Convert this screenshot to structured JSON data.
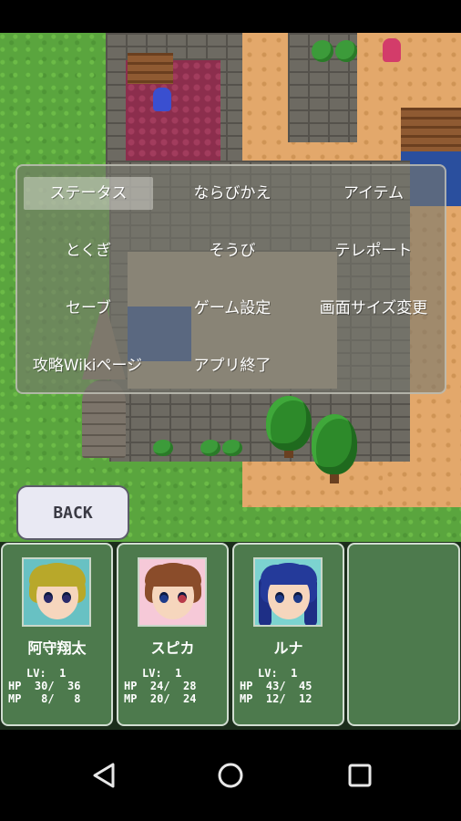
{
  "menu": {
    "items": [
      "ステータス",
      "ならびかえ",
      "アイテム",
      "とくぎ",
      "そうび",
      "テレポート",
      "セーブ",
      "ゲーム設定",
      "画面サイズ変更",
      "攻略Wikiページ",
      "アプリ終了"
    ],
    "selected_index": 0
  },
  "back_label": "BACK",
  "party": [
    {
      "name": "阿守翔太",
      "lv": "LV:  1",
      "hp": "HP  30/  36",
      "mp": "MP   8/   8"
    },
    {
      "name": "スピカ",
      "lv": "LV:  1",
      "hp": "HP  24/  28",
      "mp": "MP  20/  24"
    },
    {
      "name": "ルナ",
      "lv": "LV:  1",
      "hp": "HP  43/  45",
      "mp": "MP  12/  12"
    }
  ],
  "nav": {
    "icons": [
      "back-triangle-icon",
      "home-circle-icon",
      "recents-square-icon"
    ]
  }
}
